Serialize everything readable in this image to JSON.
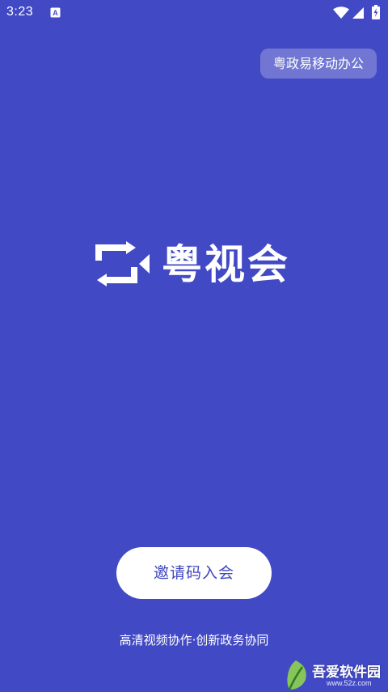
{
  "status_bar": {
    "time": "3:23",
    "app_icon_glyph": "A",
    "icons": [
      "app-notification-icon",
      "wifi-icon",
      "cell-signal-icon",
      "battery-charging-icon"
    ]
  },
  "header": {
    "switch_label": "粤政易移动办公"
  },
  "logo": {
    "name": "粤视会",
    "icon": "video-sync-logo-icon"
  },
  "actions": {
    "invite_button_label": "邀请码入会"
  },
  "footer": {
    "slogan": "高清视频协作·创新政务协同"
  },
  "watermark": {
    "name": "吾爱软件园",
    "url": "www.52z.com",
    "icon": "green-leaf-icon"
  },
  "colors": {
    "background": "#4249c5",
    "button_bg": "#ffffff",
    "button_text": "#3f46c0",
    "pill_bg": "rgba(255,255,255,0.25)"
  }
}
